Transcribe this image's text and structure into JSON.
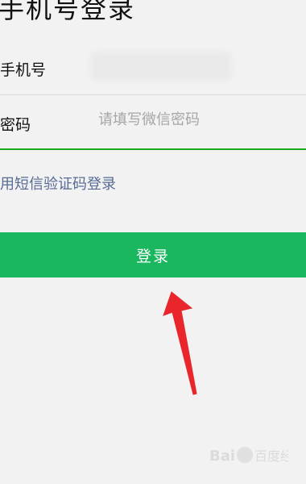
{
  "header": {
    "title": "手机号登录"
  },
  "form": {
    "phone_label": "手机号",
    "password_label": "密码",
    "password_placeholder": "请填写微信密码",
    "sms_login_link": "用短信验证码登录",
    "login_button": "登录"
  },
  "colors": {
    "primary_green": "#1ab75f",
    "link_blue": "#576b95",
    "annotation_red": "#e8262b"
  },
  "watermark": {
    "text": "Bai百度经验"
  }
}
